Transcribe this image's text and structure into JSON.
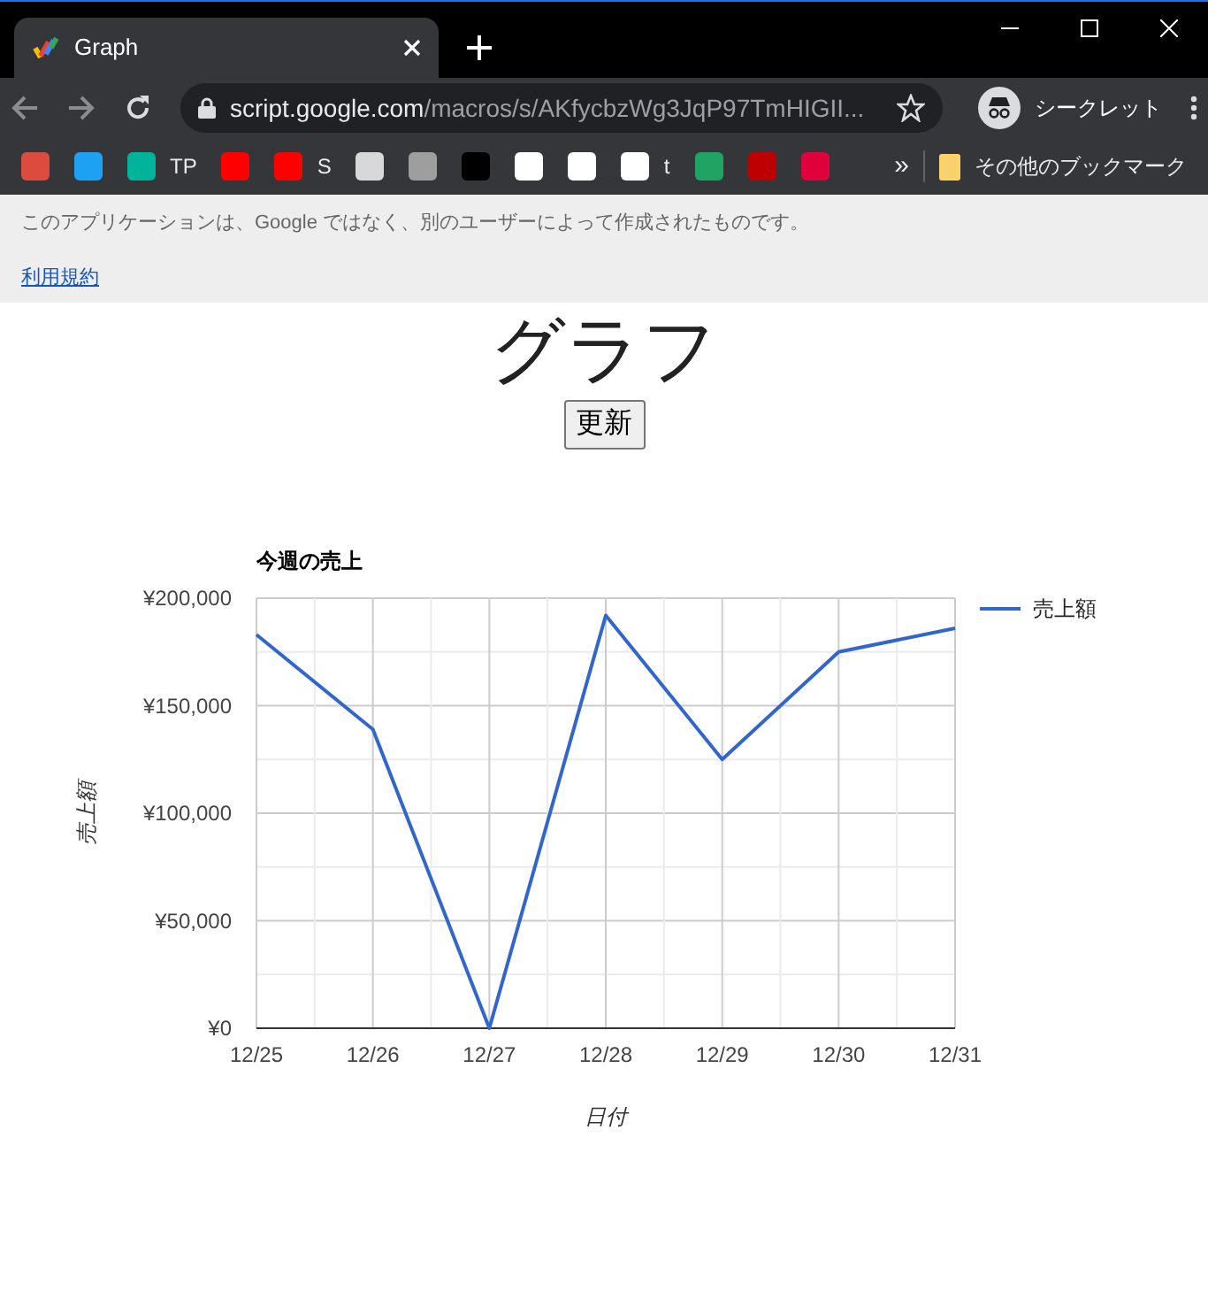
{
  "browser": {
    "tab_title": "Graph",
    "address_host": "script.google.com",
    "address_path": "/macros/s/AKfycbzWg3JqP97TmHIGII...",
    "profile_label": "シークレット",
    "bookmarks": [
      {
        "color": "#db4c3f"
      },
      {
        "color": "#1da1f2"
      },
      {
        "color": "#00b49c",
        "label": "TP"
      },
      {
        "color": "#ff0000"
      },
      {
        "color": "#ff0000",
        "label": "S"
      },
      {
        "color": "#d8d8d8"
      },
      {
        "color": "#9e9e9e"
      },
      {
        "color": "#000000"
      },
      {
        "color": "#ffffff"
      },
      {
        "color": "#ffffff"
      },
      {
        "color": "#ffffff",
        "label": "t"
      },
      {
        "color": "#1fa463"
      },
      {
        "color": "#bf0000"
      },
      {
        "color": "#e0003c"
      }
    ],
    "overflow": "»",
    "other_bookmarks": "その他のブックマーク"
  },
  "banner": {
    "notice": "このアプリケーションは、Google ではなく、別のユーザーによって作成されたものです。",
    "link": "利用規約"
  },
  "heading": "グラフ",
  "refresh_button": "更新",
  "chart": {
    "chart_data": {
      "type": "line",
      "title": "今週の売上",
      "xlabel": "日付",
      "ylabel": "売上額",
      "categories": [
        "12/25",
        "12/26",
        "12/27",
        "12/28",
        "12/29",
        "12/30",
        "12/31"
      ],
      "series": [
        {
          "name": "売上額",
          "color": "#3366cc",
          "values": [
            183000,
            139000,
            0,
            192000,
            125000,
            175000,
            186000
          ]
        }
      ],
      "ylim": [
        0,
        200000
      ],
      "grid": true,
      "yticks": [
        {
          "value": 0,
          "label": "¥0"
        },
        {
          "value": 50000,
          "label": "¥50,000"
        },
        {
          "value": 100000,
          "label": "¥100,000"
        },
        {
          "value": 150000,
          "label": "¥150,000"
        },
        {
          "value": 200000,
          "label": "¥200,000"
        }
      ]
    }
  }
}
